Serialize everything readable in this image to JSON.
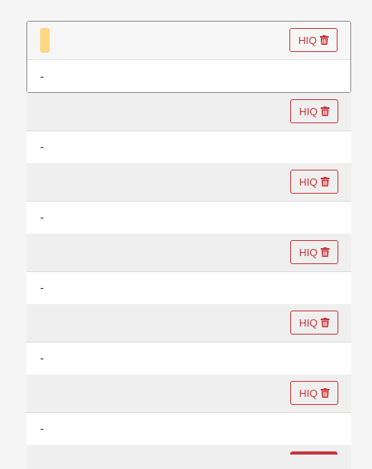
{
  "accent_color": "#c9373c",
  "tag_color": "#fdd783",
  "items": [
    {
      "button_label": "HIQ",
      "body_text": "-",
      "selected": true
    },
    {
      "button_label": "HIQ",
      "body_text": "-"
    },
    {
      "button_label": "HIQ",
      "body_text": "-"
    },
    {
      "button_label": "HIQ",
      "body_text": "-"
    },
    {
      "button_label": "HIQ",
      "body_text": "-"
    },
    {
      "button_label": "HIQ",
      "body_text": "-"
    }
  ]
}
